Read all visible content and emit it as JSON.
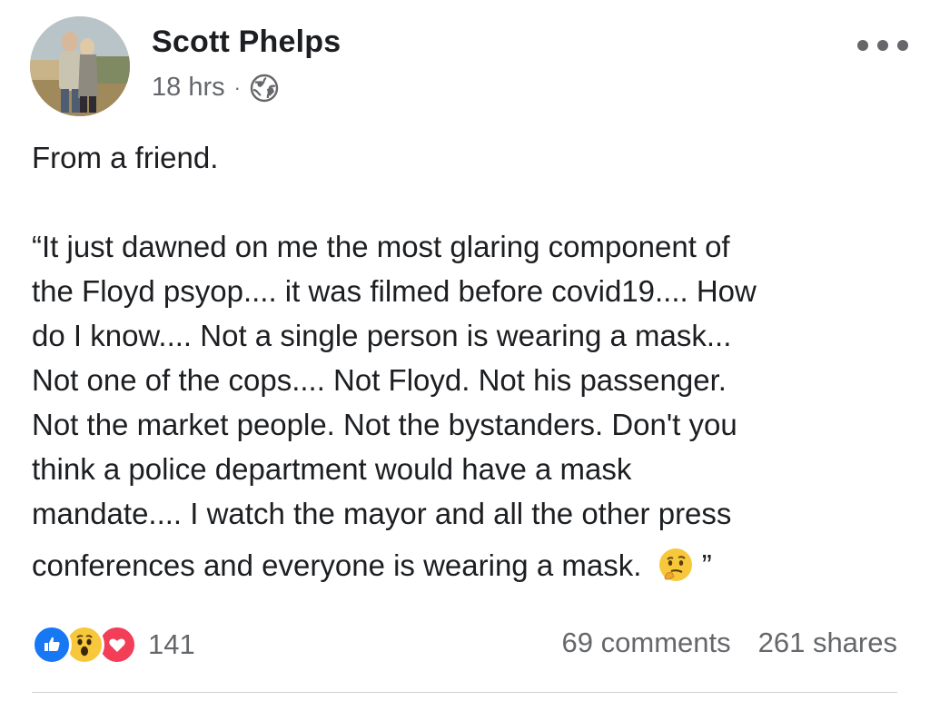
{
  "post": {
    "author": "Scott Phelps",
    "timestamp": "18 hrs",
    "separator": "·",
    "privacy_icon": "globe-icon",
    "more_icon": "more-options-icon",
    "intro": "From a friend.",
    "quote_lines": [
      "“It just dawned on me the most glaring component of",
      "the Floyd psyop.... it was filmed before covid19.... How",
      "do I know.... Not a single person is wearing a mask...",
      "Not one of the cops.... Not Floyd. Not his passenger.",
      "Not the market people. Not the bystanders. Don't you",
      "think a police department would have a mask",
      "mandate.... I watch the mayor and all the other press"
    ],
    "last_line": "conferences and everyone is wearing a mask.",
    "last_line_emoji": "thinking-face-emoji",
    "closing_quote": "”"
  },
  "footer": {
    "reaction_icons": [
      "like-icon",
      "wow-icon",
      "love-icon"
    ],
    "reaction_count": "141",
    "comments": "69 comments",
    "shares": "261 shares"
  },
  "colors": {
    "text": "#1c1e21",
    "secondary": "#65676b",
    "like_blue": "#1877f2",
    "love_red": "#f33e58",
    "wow_yellow": "#f7c83b"
  }
}
